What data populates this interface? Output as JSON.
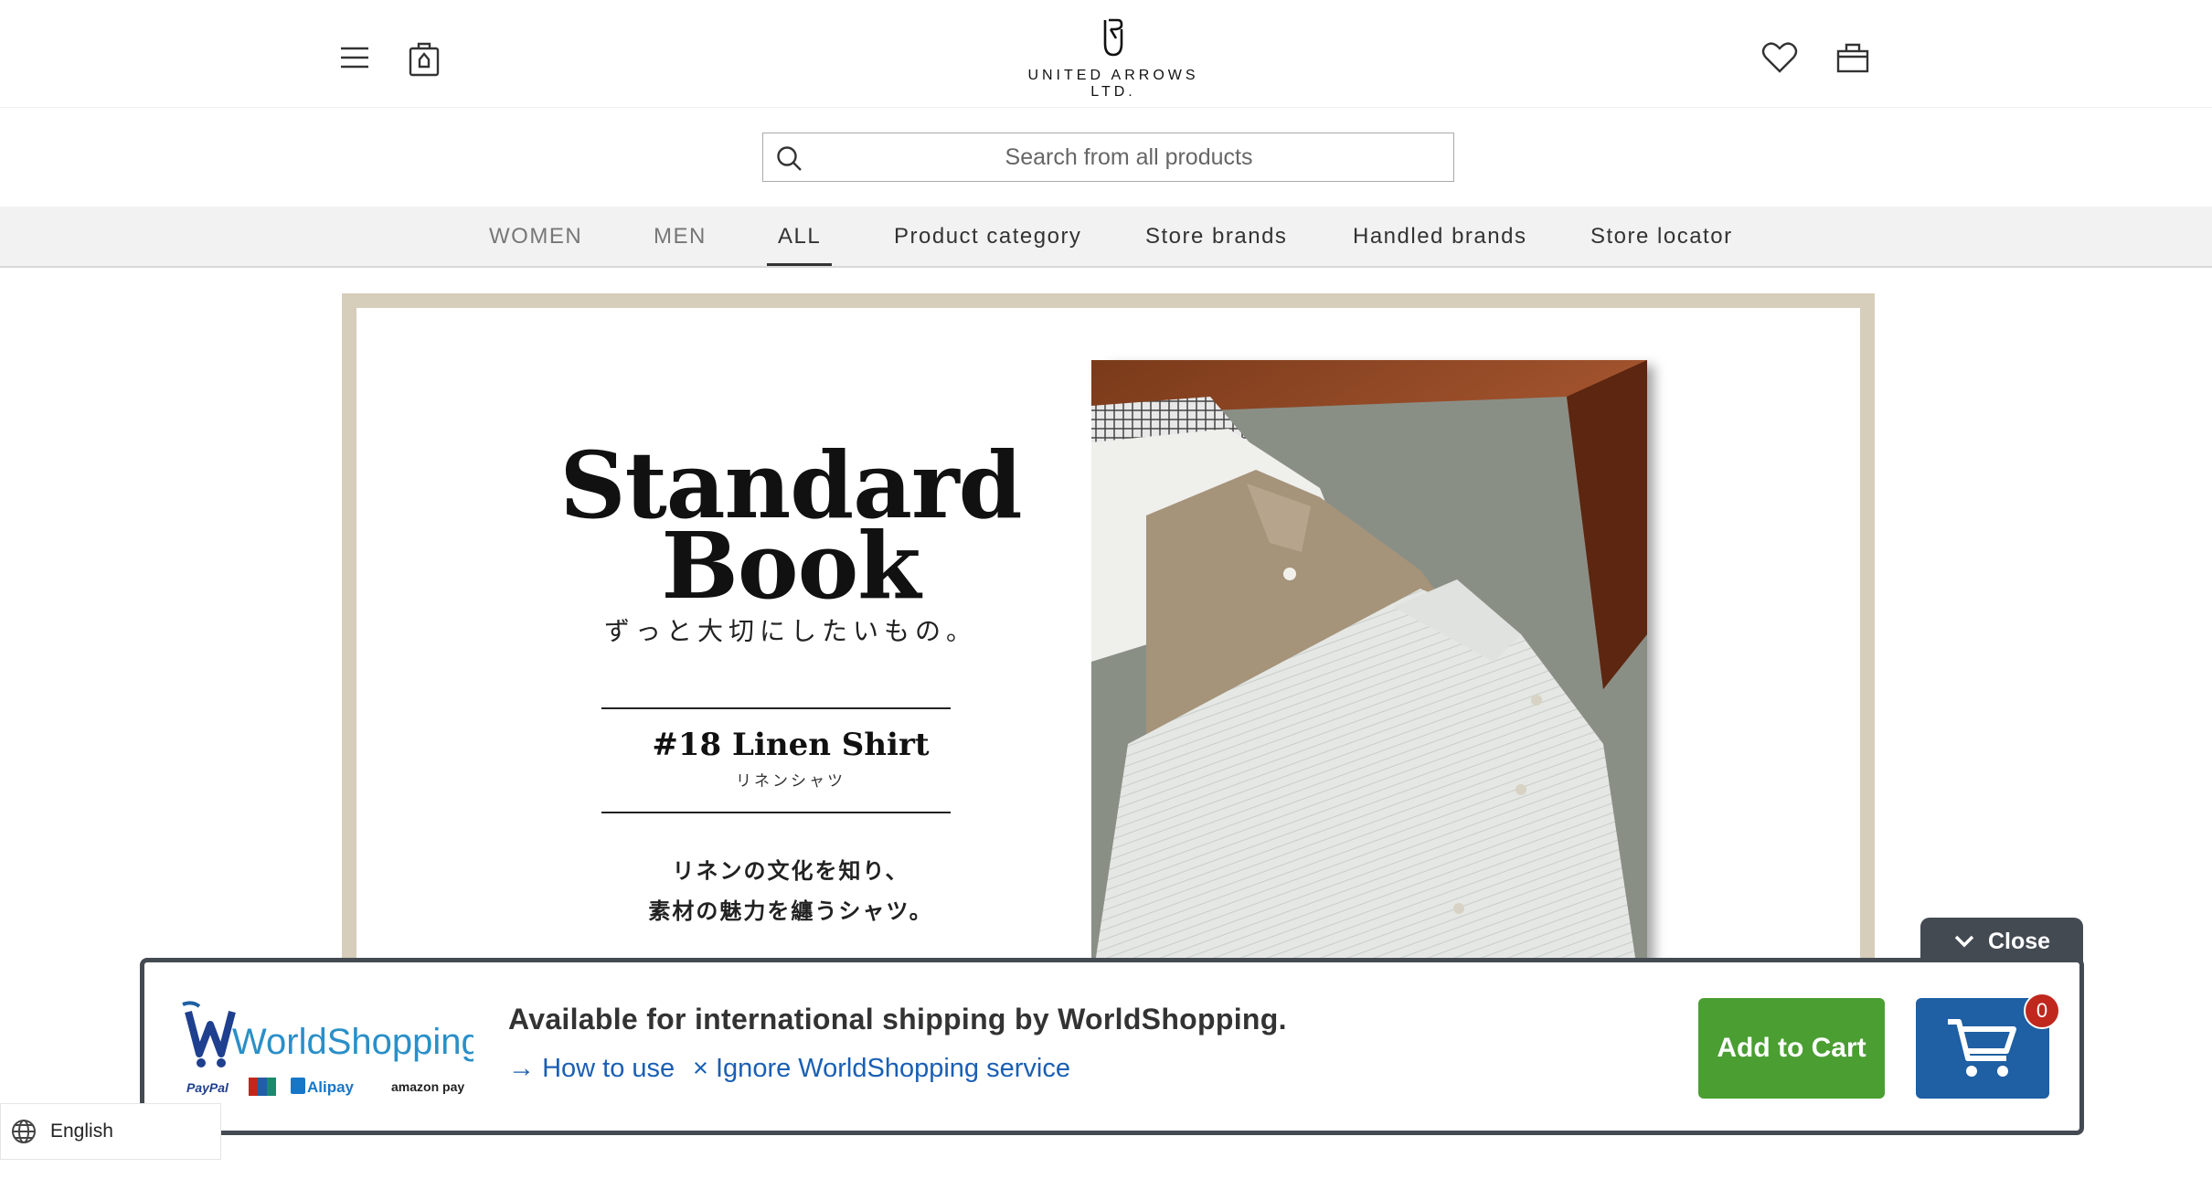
{
  "header": {
    "brand": "UNITED ARROWS LTD.",
    "menu_icon": "hamburger-menu-icon",
    "recent_icon": "clipboard-tag-icon",
    "wishlist_icon": "heart-icon",
    "bag_icon": "shopping-bag-icon"
  },
  "search": {
    "placeholder": "Search from all products",
    "icon": "search-icon"
  },
  "nav": {
    "items": [
      {
        "label": "WOMEN"
      },
      {
        "label": "MEN"
      },
      {
        "label": "ALL"
      },
      {
        "label": "Product category"
      },
      {
        "label": "Store brands"
      },
      {
        "label": "Handled brands"
      },
      {
        "label": "Store locator"
      }
    ],
    "active": "ALL"
  },
  "banner": {
    "title_line1": "Standard",
    "title_line2": "Book",
    "subtitle": "ずっと大切にしたいもの。",
    "issue": "#18 Linen Shirt",
    "issue_jp": "リネンシャツ",
    "tagline_1": "リネンの文化を知り、",
    "tagline_2": "素材の魅力を纏うシャツ。",
    "frame_color": "#d6cdbb"
  },
  "worldshopping": {
    "close_label": "Close",
    "logo_text": "WorldShopping",
    "payment_labels": [
      "PayPal",
      "Alipay",
      "amazon pay"
    ],
    "headline": "Available for international shipping by WorldShopping.",
    "how_to_use": "How to use",
    "ignore": "Ignore WorldShopping service",
    "add_to_cart": "Add to Cart",
    "cart_count": "0",
    "colors": {
      "green": "#4a9e32",
      "blue": "#1f5fa3",
      "dark": "#444a52",
      "badge": "#c0281e"
    }
  },
  "language": {
    "label": "English",
    "icon": "globe-icon"
  }
}
